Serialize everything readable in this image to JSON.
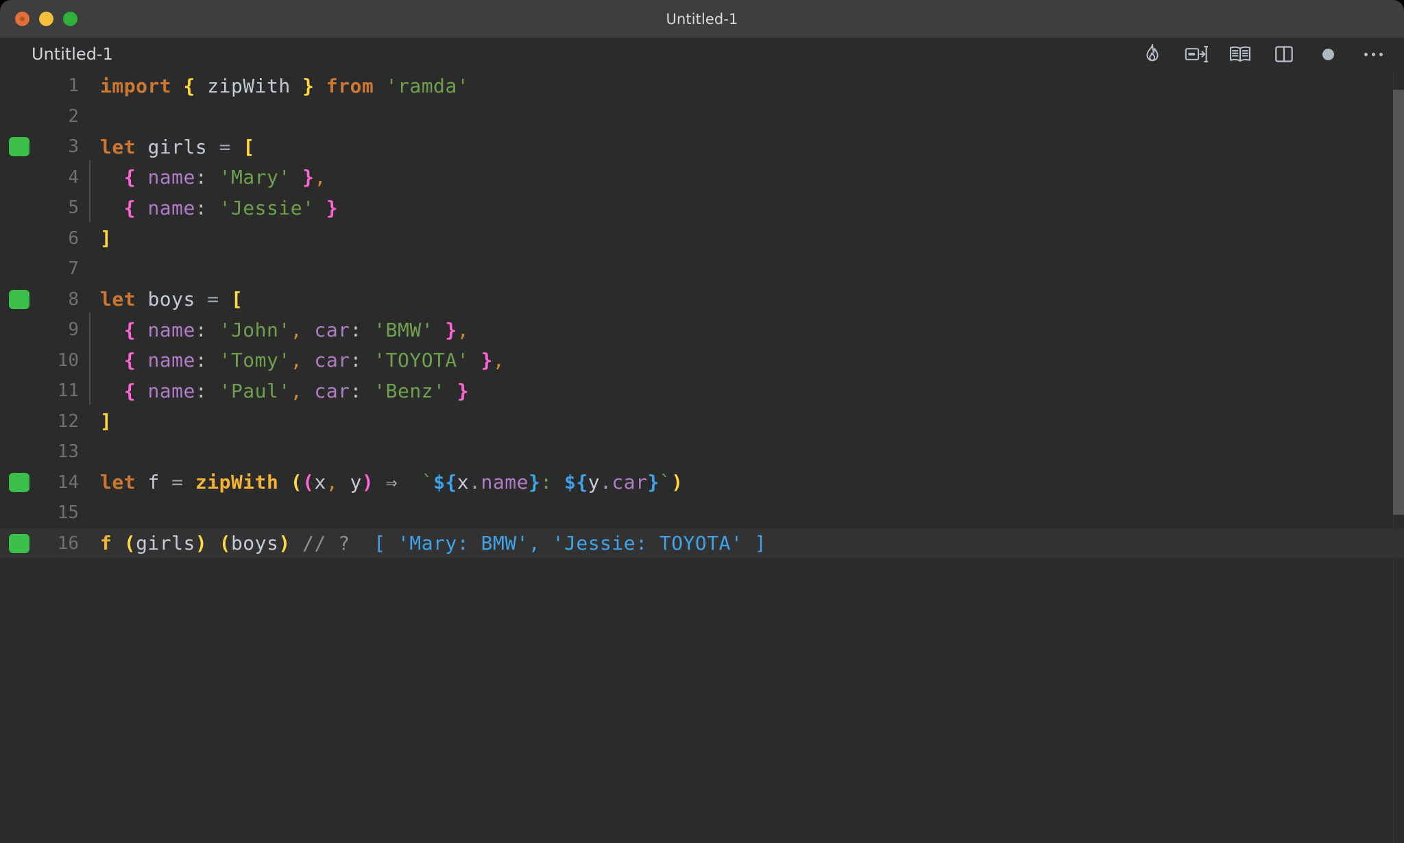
{
  "window": {
    "title": "Untitled-1",
    "traffic_lights": [
      "close-button",
      "minimize-button",
      "maximize-button"
    ]
  },
  "tabbar": {
    "tab_label": "Untitled-1",
    "toolbar_icons": [
      "flame-icon",
      "run-split-icon",
      "open-book-icon",
      "split-editor-icon",
      "record-dot-icon",
      "more-options-icon"
    ]
  },
  "editor": {
    "current_line": 16,
    "breakpoint_lines": [
      3,
      8,
      14,
      16
    ],
    "lines": [
      {
        "n": "1",
        "tokens": [
          {
            "t": "import",
            "c": "kw"
          },
          {
            "t": " ",
            "c": "op"
          },
          {
            "t": "{",
            "c": "brk-y"
          },
          {
            "t": " ",
            "c": "op"
          },
          {
            "t": "zipWith",
            "c": "ident"
          },
          {
            "t": " ",
            "c": "op"
          },
          {
            "t": "}",
            "c": "brk-y"
          },
          {
            "t": " ",
            "c": "op"
          },
          {
            "t": "from",
            "c": "kw"
          },
          {
            "t": " ",
            "c": "op"
          },
          {
            "t": "'ramda'",
            "c": "str"
          }
        ]
      },
      {
        "n": "2",
        "tokens": []
      },
      {
        "n": "3",
        "tokens": [
          {
            "t": "let",
            "c": "kw"
          },
          {
            "t": " ",
            "c": "op"
          },
          {
            "t": "girls",
            "c": "ident"
          },
          {
            "t": " ",
            "c": "op"
          },
          {
            "t": "=",
            "c": "op"
          },
          {
            "t": " ",
            "c": "op"
          },
          {
            "t": "[",
            "c": "brk-y"
          }
        ]
      },
      {
        "n": "4",
        "indent": true,
        "tokens": [
          {
            "t": "  ",
            "c": "op"
          },
          {
            "t": "{",
            "c": "brk-m"
          },
          {
            "t": " ",
            "c": "op"
          },
          {
            "t": "name",
            "c": "prop"
          },
          {
            "t": ":",
            "c": "colon"
          },
          {
            "t": " ",
            "c": "op"
          },
          {
            "t": "'Mary'",
            "c": "str"
          },
          {
            "t": " ",
            "c": "op"
          },
          {
            "t": "}",
            "c": "brk-m"
          },
          {
            "t": ",",
            "c": "comma"
          }
        ]
      },
      {
        "n": "5",
        "indent": true,
        "tokens": [
          {
            "t": "  ",
            "c": "op"
          },
          {
            "t": "{",
            "c": "brk-m"
          },
          {
            "t": " ",
            "c": "op"
          },
          {
            "t": "name",
            "c": "prop"
          },
          {
            "t": ":",
            "c": "colon"
          },
          {
            "t": " ",
            "c": "op"
          },
          {
            "t": "'Jessie'",
            "c": "str"
          },
          {
            "t": " ",
            "c": "op"
          },
          {
            "t": "}",
            "c": "brk-m"
          }
        ]
      },
      {
        "n": "6",
        "tokens": [
          {
            "t": "]",
            "c": "brk-y"
          }
        ]
      },
      {
        "n": "7",
        "tokens": []
      },
      {
        "n": "8",
        "tokens": [
          {
            "t": "let",
            "c": "kw"
          },
          {
            "t": " ",
            "c": "op"
          },
          {
            "t": "boys",
            "c": "ident"
          },
          {
            "t": " ",
            "c": "op"
          },
          {
            "t": "=",
            "c": "op"
          },
          {
            "t": " ",
            "c": "op"
          },
          {
            "t": "[",
            "c": "brk-y"
          }
        ]
      },
      {
        "n": "9",
        "indent": true,
        "tokens": [
          {
            "t": "  ",
            "c": "op"
          },
          {
            "t": "{",
            "c": "brk-m"
          },
          {
            "t": " ",
            "c": "op"
          },
          {
            "t": "name",
            "c": "prop"
          },
          {
            "t": ":",
            "c": "colon"
          },
          {
            "t": " ",
            "c": "op"
          },
          {
            "t": "'John'",
            "c": "str"
          },
          {
            "t": ",",
            "c": "comma"
          },
          {
            "t": " ",
            "c": "op"
          },
          {
            "t": "car",
            "c": "prop"
          },
          {
            "t": ":",
            "c": "colon"
          },
          {
            "t": " ",
            "c": "op"
          },
          {
            "t": "'BMW'",
            "c": "str"
          },
          {
            "t": " ",
            "c": "op"
          },
          {
            "t": "}",
            "c": "brk-m"
          },
          {
            "t": ",",
            "c": "comma"
          }
        ]
      },
      {
        "n": "10",
        "indent": true,
        "tokens": [
          {
            "t": "  ",
            "c": "op"
          },
          {
            "t": "{",
            "c": "brk-m"
          },
          {
            "t": " ",
            "c": "op"
          },
          {
            "t": "name",
            "c": "prop"
          },
          {
            "t": ":",
            "c": "colon"
          },
          {
            "t": " ",
            "c": "op"
          },
          {
            "t": "'Tomy'",
            "c": "str"
          },
          {
            "t": ",",
            "c": "comma"
          },
          {
            "t": " ",
            "c": "op"
          },
          {
            "t": "car",
            "c": "prop"
          },
          {
            "t": ":",
            "c": "colon"
          },
          {
            "t": " ",
            "c": "op"
          },
          {
            "t": "'TOYOTA'",
            "c": "str"
          },
          {
            "t": " ",
            "c": "op"
          },
          {
            "t": "}",
            "c": "brk-m"
          },
          {
            "t": ",",
            "c": "comma"
          }
        ]
      },
      {
        "n": "11",
        "indent": true,
        "tokens": [
          {
            "t": "  ",
            "c": "op"
          },
          {
            "t": "{",
            "c": "brk-m"
          },
          {
            "t": " ",
            "c": "op"
          },
          {
            "t": "name",
            "c": "prop"
          },
          {
            "t": ":",
            "c": "colon"
          },
          {
            "t": " ",
            "c": "op"
          },
          {
            "t": "'Paul'",
            "c": "str"
          },
          {
            "t": ",",
            "c": "comma"
          },
          {
            "t": " ",
            "c": "op"
          },
          {
            "t": "car",
            "c": "prop"
          },
          {
            "t": ":",
            "c": "colon"
          },
          {
            "t": " ",
            "c": "op"
          },
          {
            "t": "'Benz'",
            "c": "str"
          },
          {
            "t": " ",
            "c": "op"
          },
          {
            "t": "}",
            "c": "brk-m"
          }
        ]
      },
      {
        "n": "12",
        "tokens": [
          {
            "t": "]",
            "c": "brk-y"
          }
        ]
      },
      {
        "n": "13",
        "tokens": []
      },
      {
        "n": "14",
        "tokens": [
          {
            "t": "let",
            "c": "kw"
          },
          {
            "t": " ",
            "c": "op"
          },
          {
            "t": "f",
            "c": "ident"
          },
          {
            "t": " ",
            "c": "op"
          },
          {
            "t": "=",
            "c": "op"
          },
          {
            "t": " ",
            "c": "op"
          },
          {
            "t": "zipWith",
            "c": "fn"
          },
          {
            "t": " ",
            "c": "op"
          },
          {
            "t": "(",
            "c": "brk-y"
          },
          {
            "t": "(",
            "c": "brk-m"
          },
          {
            "t": "x",
            "c": "ident"
          },
          {
            "t": ",",
            "c": "comma"
          },
          {
            "t": " ",
            "c": "op"
          },
          {
            "t": "y",
            "c": "ident"
          },
          {
            "t": ")",
            "c": "brk-m"
          },
          {
            "t": " ",
            "c": "op"
          },
          {
            "t": "⇒",
            "c": "arrow"
          },
          {
            "t": "  ",
            "c": "op"
          },
          {
            "t": "`",
            "c": "tick"
          },
          {
            "t": "${",
            "c": "tpl"
          },
          {
            "t": "x",
            "c": "ident"
          },
          {
            "t": ".",
            "c": "op"
          },
          {
            "t": "name",
            "c": "prop"
          },
          {
            "t": "}",
            "c": "tpl"
          },
          {
            "t": ":",
            "c": "scolon"
          },
          {
            "t": " ",
            "c": "op"
          },
          {
            "t": "${",
            "c": "tpl"
          },
          {
            "t": "y",
            "c": "ident"
          },
          {
            "t": ".",
            "c": "op"
          },
          {
            "t": "car",
            "c": "prop"
          },
          {
            "t": "}",
            "c": "tpl"
          },
          {
            "t": "`",
            "c": "tick"
          },
          {
            "t": ")",
            "c": "brk-y"
          }
        ]
      },
      {
        "n": "15",
        "tokens": []
      },
      {
        "n": "16",
        "current": true,
        "tokens": [
          {
            "t": "f",
            "c": "fn"
          },
          {
            "t": " ",
            "c": "op"
          },
          {
            "t": "(",
            "c": "brk-y"
          },
          {
            "t": "girls",
            "c": "ident"
          },
          {
            "t": ")",
            "c": "brk-y"
          },
          {
            "t": " ",
            "c": "op"
          },
          {
            "t": "(",
            "c": "brk-y"
          },
          {
            "t": "boys",
            "c": "ident"
          },
          {
            "t": ")",
            "c": "brk-y"
          },
          {
            "t": " ",
            "c": "op"
          },
          {
            "t": "//",
            "c": "cmt"
          },
          {
            "t": " ",
            "c": "op"
          },
          {
            "t": "?",
            "c": "cmt"
          },
          {
            "t": "  ",
            "c": "op"
          },
          {
            "t": "[ 'Mary: BMW', 'Jessie: TOYOTA' ]",
            "c": "blue"
          }
        ]
      }
    ]
  },
  "colors": {
    "titlebar_bg": "#3e3e3e",
    "editor_bg": "#2b2b2b",
    "current_line_bg": "#323232",
    "keyword": "#cc7832",
    "string": "#6ea04e",
    "property": "#b07cc6",
    "bracket_yellow": "#ffd93d",
    "bracket_magenta": "#ff64d4",
    "bracket_blue": "#2e9ee0",
    "comment": "#8a9099",
    "breakpoint_green": "#3bbf4a",
    "identifier": "#c3cad6"
  }
}
